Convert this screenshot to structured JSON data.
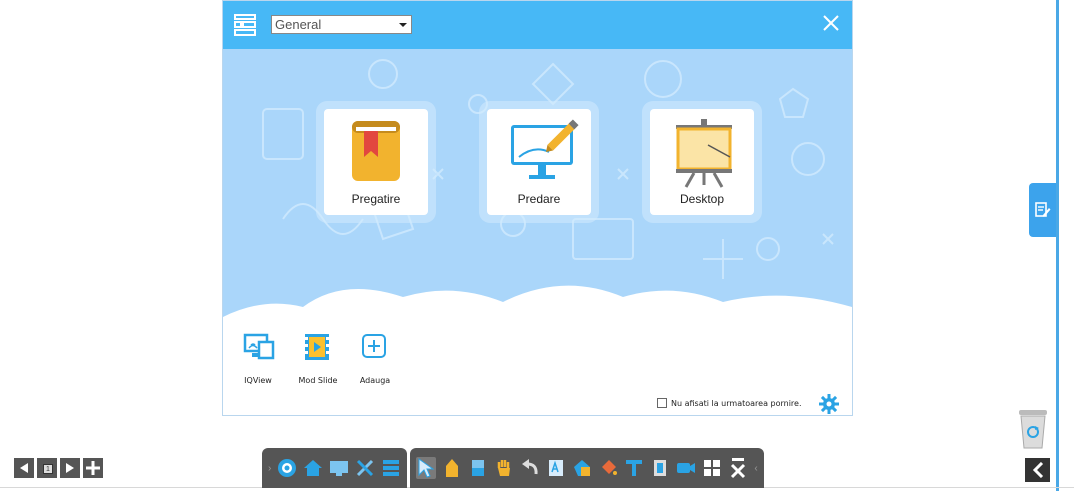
{
  "window": {
    "category_value": "General",
    "close_icon": "close-icon"
  },
  "cards": [
    {
      "label": "Pregatire",
      "icon": "book-icon"
    },
    {
      "label": "Predare",
      "icon": "monitor-pen-icon"
    },
    {
      "label": "Desktop",
      "icon": "easel-board-icon"
    }
  ],
  "tools": [
    {
      "label": "IQView",
      "icon": "screen-share-icon"
    },
    {
      "label": "Mod Slide",
      "icon": "film-slide-icon"
    },
    {
      "label": "Adauga",
      "icon": "add-icon"
    }
  ],
  "footer": {
    "dont_show_label": "Nu afisati la urmatoarea pornire.",
    "dont_show_checked": false
  },
  "page_nav": {
    "current_page": "1"
  },
  "colors": {
    "titlebar": "#47b8f6",
    "background": "#aad6fa",
    "rail": "#4aa8e6",
    "toolbar": "#555555"
  }
}
